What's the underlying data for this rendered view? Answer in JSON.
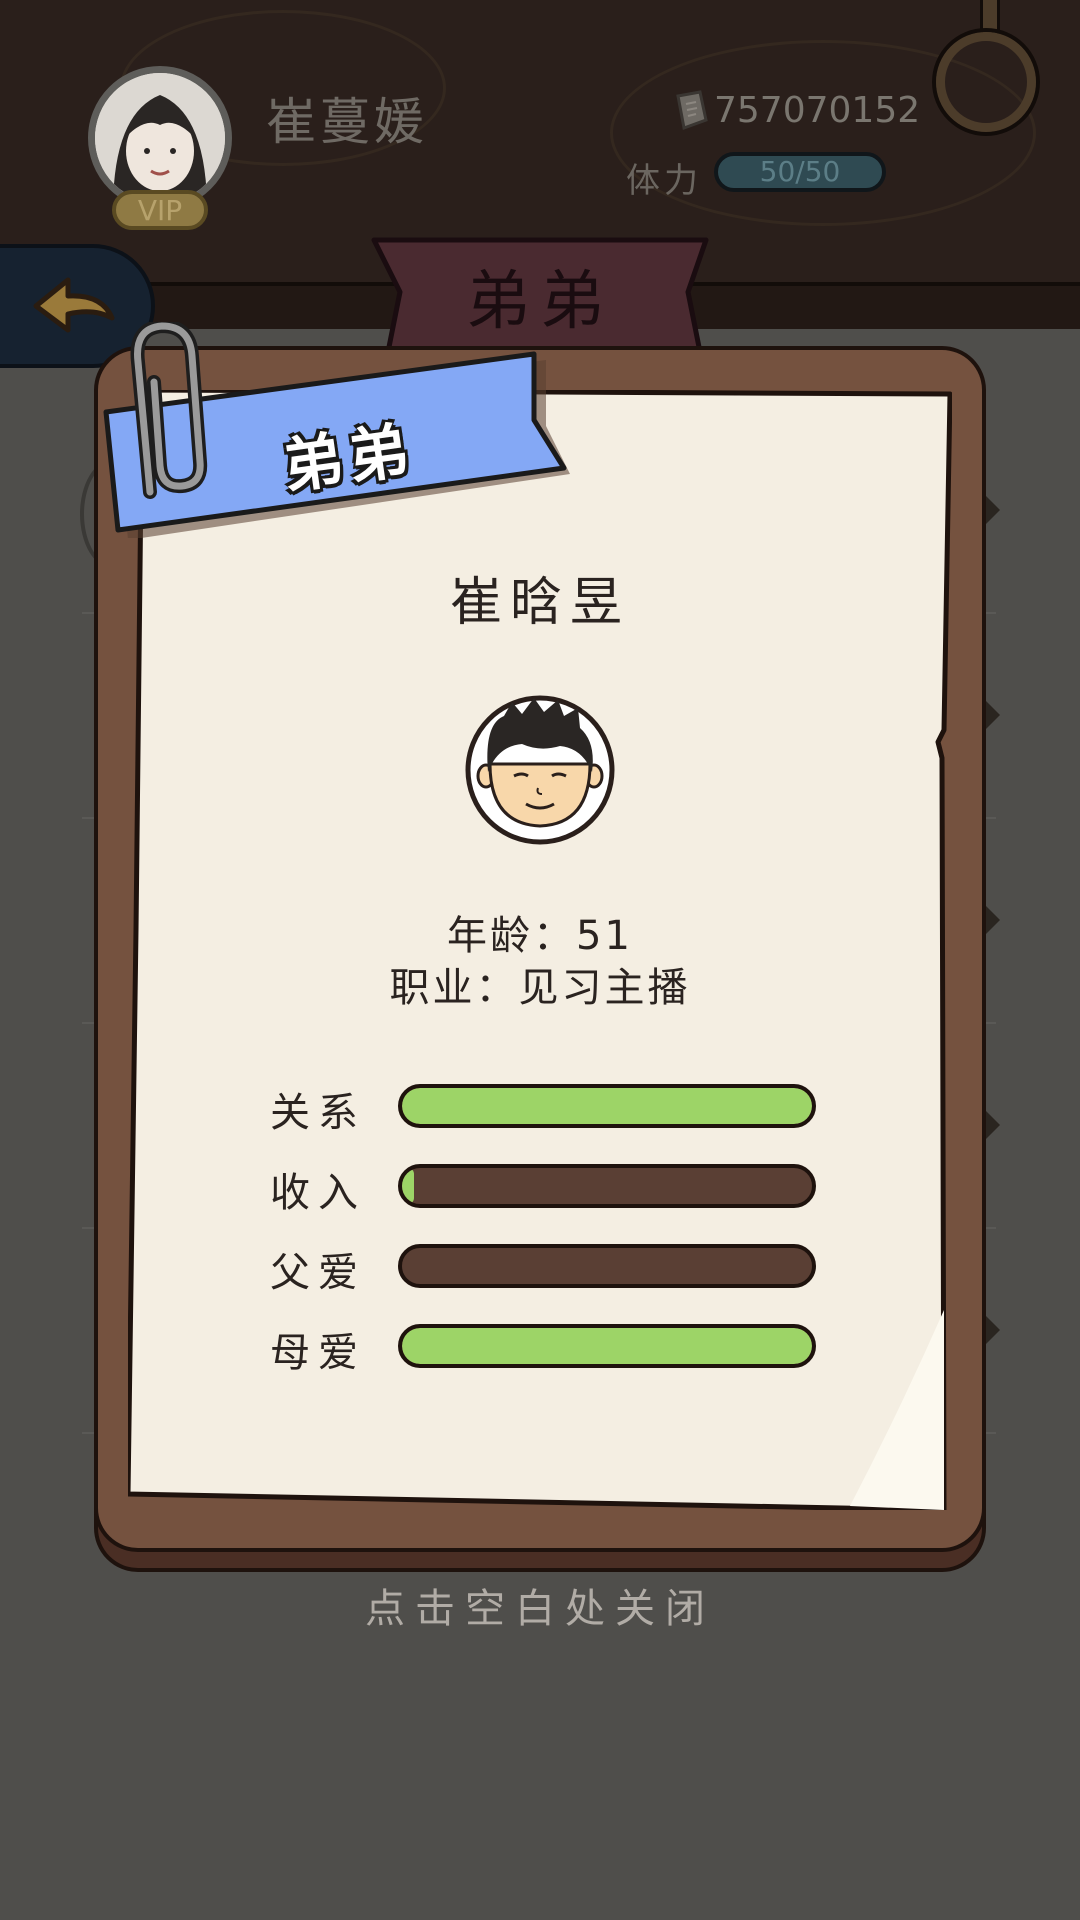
{
  "player": {
    "name": "崔蔓媛",
    "vip_label": "VIP",
    "money": "757070152",
    "stamina_label": "体力",
    "stamina_value": "50/50"
  },
  "page": {
    "banner_title": "弟弟"
  },
  "popup": {
    "ribbon_title": "弟弟",
    "character_name": "崔晗昱",
    "age_line": "年龄：51",
    "job_line": "职业：见习主播",
    "stats": [
      {
        "label": "关系",
        "value": 1.0
      },
      {
        "label": "收入",
        "value": 0.03
      },
      {
        "label": "父爱",
        "value": 0.0
      },
      {
        "label": "母爱",
        "value": 1.0
      }
    ],
    "close_hint": "点击空白处关闭"
  },
  "colors": {
    "bar_fill": "#9dd467",
    "bar_track": "#5a3f34",
    "ribbon_blue": "#84a8f5",
    "top_banner": "#4a2a30"
  }
}
